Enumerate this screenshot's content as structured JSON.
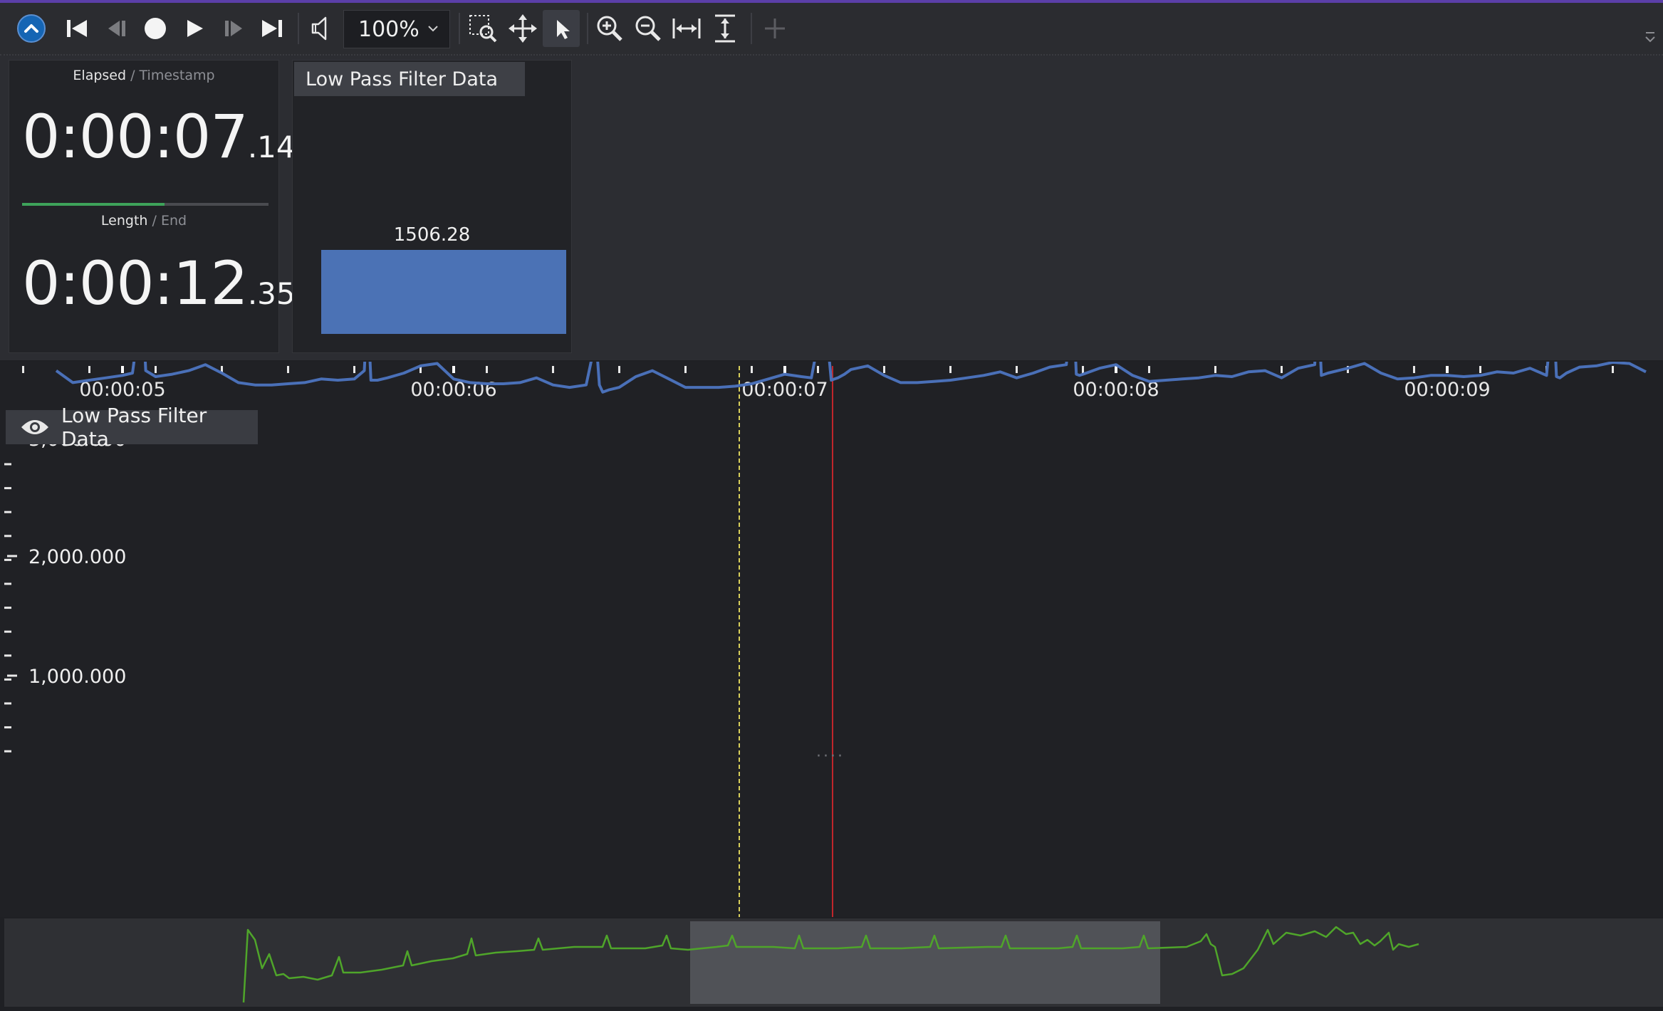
{
  "toolbar": {
    "zoom_value": "100%",
    "buttons": [
      "collapse",
      "skip-to-start",
      "step-back",
      "record",
      "play",
      "step-forward",
      "skip-to-end",
      "volume",
      "zoom-select-region",
      "pan",
      "pointer",
      "zoom-in",
      "zoom-out",
      "fit-horizontal",
      "fit-vertical",
      "add"
    ]
  },
  "clock": {
    "elapsed_label": "Elapsed",
    "timestamp_label": " / Timestamp",
    "elapsed_main": "0:00:07",
    "elapsed_ms": ".140",
    "length_label": "Length",
    "end_label": " / End",
    "length_main": "0:00:12",
    "length_ms": ".351",
    "progress": 0.578
  },
  "bar_panel": {
    "title": "Low Pass Filter Data",
    "value_text": "1506.28",
    "value": 1506.28
  },
  "series_tag": {
    "label": "Low Pass Filter Data"
  },
  "colors": {
    "series": "#4a70b8",
    "overview_series": "#4fa52a",
    "playhead": "#c0262b",
    "cursor": "#d8cf5a",
    "progress": "#3ea35a"
  },
  "chart_data": {
    "type": "line",
    "title": "",
    "x_axis": {
      "ticks": [
        "00:00:05",
        "00:00:06",
        "00:00:07",
        "00:00:08",
        "00:00:09"
      ],
      "visible_range_s": [
        4.8,
        9.6
      ]
    },
    "y_axis": {
      "labels": [
        "3,000.000",
        "2,000.000",
        "1,000.000"
      ],
      "range": [
        0,
        3100
      ]
    },
    "playhead_time_s": 7.14,
    "cursor_time_s": 6.86,
    "series": [
      {
        "name": "Low Pass Filter Data",
        "x": [
          4.8,
          4.85,
          4.9,
          4.95,
          5.0,
          5.03,
          5.06,
          5.07,
          5.1,
          5.15,
          5.2,
          5.25,
          5.3,
          5.35,
          5.4,
          5.45,
          5.5,
          5.55,
          5.6,
          5.65,
          5.7,
          5.73,
          5.74,
          5.75,
          5.77,
          5.8,
          5.85,
          5.9,
          5.95,
          6.0,
          6.05,
          6.1,
          6.15,
          6.2,
          6.25,
          6.3,
          6.35,
          6.4,
          6.43,
          6.44,
          6.45,
          6.47,
          6.5,
          6.55,
          6.6,
          6.65,
          6.7,
          6.75,
          6.8,
          6.85,
          6.9,
          6.95,
          7.0,
          7.05,
          7.08,
          7.12,
          7.14,
          7.15,
          7.16,
          7.18,
          7.2,
          7.25,
          7.3,
          7.35,
          7.4,
          7.45,
          7.5,
          7.55,
          7.6,
          7.65,
          7.7,
          7.75,
          7.8,
          7.85,
          7.87,
          7.88,
          7.89,
          7.91,
          7.95,
          8.0,
          8.05,
          8.1,
          8.15,
          8.2,
          8.25,
          8.3,
          8.35,
          8.4,
          8.45,
          8.5,
          8.55,
          8.6,
          8.61,
          8.62,
          8.64,
          8.7,
          8.75,
          8.8,
          8.85,
          8.9,
          8.95,
          9.0,
          9.05,
          9.1,
          9.15,
          9.2,
          9.25,
          9.3,
          9.32,
          9.33,
          9.34,
          9.36,
          9.4,
          9.45,
          9.5,
          9.55,
          9.6
        ],
        "y": [
          2000,
          1900,
          1920,
          1940,
          1960,
          1980,
          2600,
          2000,
          1950,
          1970,
          2000,
          2050,
          1980,
          1900,
          1880,
          1880,
          1890,
          1900,
          1930,
          1920,
          1930,
          2000,
          2530,
          1920,
          1920,
          1940,
          1980,
          2040,
          2060,
          1930,
          1900,
          1890,
          1890,
          1900,
          1940,
          1880,
          1860,
          1880,
          2270,
          1880,
          1820,
          1840,
          1860,
          1950,
          2000,
          1930,
          1860,
          1860,
          1860,
          1870,
          1890,
          1930,
          1970,
          1950,
          1940,
          2520,
          1920,
          1930,
          1940,
          1970,
          2010,
          2040,
          1960,
          1900,
          1900,
          1910,
          1920,
          1940,
          1960,
          1990,
          1940,
          1980,
          2030,
          2050,
          2620,
          1970,
          1960,
          1980,
          2020,
          2050,
          1960,
          1910,
          1920,
          1930,
          1940,
          1960,
          1950,
          1990,
          2000,
          1940,
          2020,
          2050,
          2590,
          1960,
          1980,
          2020,
          2060,
          1980,
          1930,
          1940,
          1960,
          1960,
          1950,
          1960,
          1990,
          1980,
          2020,
          1960,
          2560,
          1950,
          1940,
          1980,
          2030,
          2040,
          2070,
          2060,
          1990
        ]
      }
    ]
  }
}
